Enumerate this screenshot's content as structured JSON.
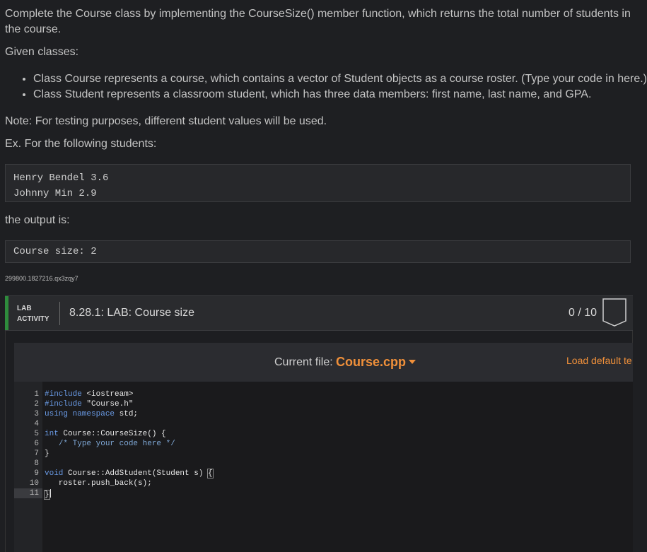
{
  "prose": {
    "intro": "Complete the Course class by implementing the CourseSize() member function, which returns the total number of students in the course.",
    "given_heading": "Given classes:",
    "given_items": [
      "Class Course represents a course, which contains a vector of Student objects as a course roster. (Type your code in here.)",
      "Class Student represents a classroom student, which has three data members: first name, last name, and GPA."
    ],
    "note": "Note: For testing purposes, different student values will be used.",
    "example_heading": "Ex. For the following students:",
    "output_heading": "the output is:"
  },
  "example": {
    "input_lines": [
      "Henry Bendel 3.6",
      "Johnny Min 2.9"
    ],
    "output_lines": [
      "Course size: 2"
    ]
  },
  "lab_id": "299800.1827216.qx3zqy7",
  "lab": {
    "label_line1": "LAB",
    "label_line2": "ACTIVITY",
    "title": "8.28.1: LAB: Course size",
    "score": "0 / 10",
    "accent_color": "#2e8b3c"
  },
  "editor": {
    "current_file_label": "Current file:",
    "current_file": "Course.cpp",
    "load_default": "Load default te",
    "accent_color": "#f0903a",
    "line_numbers": [
      "1",
      "2",
      "3",
      "4",
      "5",
      "6",
      "7",
      "8",
      "9",
      "10",
      "11"
    ]
  }
}
